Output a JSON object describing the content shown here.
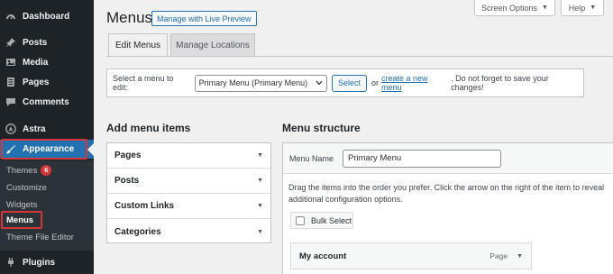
{
  "sidebar": {
    "dashboard": "Dashboard",
    "posts": "Posts",
    "media": "Media",
    "pages": "Pages",
    "comments": "Comments",
    "astra": "Astra",
    "appearance": "Appearance",
    "submenu": {
      "themes": "Themes",
      "themes_badge": "6",
      "customize": "Customize",
      "widgets": "Widgets",
      "menus": "Menus",
      "theme_file_editor": "Theme File Editor"
    },
    "plugins": "Plugins"
  },
  "top": {
    "screen_options": "Screen Options",
    "help": "Help"
  },
  "header": {
    "title": "Menus",
    "live_preview": "Manage with Live Preview"
  },
  "tabs": [
    {
      "label": "Edit Menus",
      "active": true
    },
    {
      "label": "Manage Locations",
      "active": false
    }
  ],
  "select_bar": {
    "label": "Select a menu to edit:",
    "selected": "Primary Menu (Primary Menu)",
    "button": "Select",
    "or": "or",
    "link": "create a new menu",
    "tail": ". Do not forget to save your changes!"
  },
  "add_items": {
    "heading": "Add menu items",
    "sections": [
      "Pages",
      "Posts",
      "Custom Links",
      "Categories"
    ]
  },
  "structure": {
    "heading": "Menu structure",
    "name_label": "Menu Name",
    "name_value": "Primary Menu",
    "instructions": "Drag the items into the order you prefer. Click the arrow on the right of the item to reveal additional configuration options.",
    "bulk_select": "Bulk Select",
    "items": [
      {
        "title": "My account",
        "type": "Page"
      }
    ]
  },
  "colors": {
    "accent": "#2271b1",
    "sidebar_bg": "#1d2327",
    "highlight_box": "#d63638"
  }
}
